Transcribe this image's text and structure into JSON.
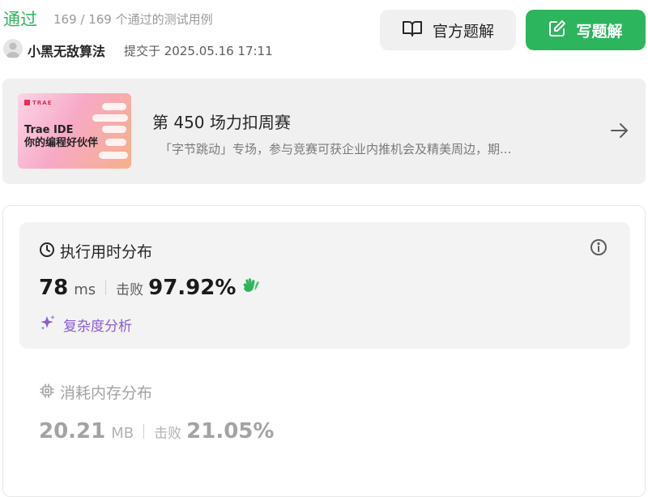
{
  "header": {
    "status": "通过",
    "passed_cases": "169 / 169 个通过的测试用例",
    "user_name": "小黑无敌算法",
    "submitted": "提交于 2025.05.16 17:11",
    "official_solution_label": "官方题解",
    "write_solution_label": "写题解"
  },
  "banner": {
    "promo_logo": "TRAE",
    "promo_title_line1": "Trae IDE",
    "promo_title_line2": "你的编程好伙伴",
    "title": "第 450 场力扣周赛",
    "description": "「字节跳动」专场，参与竞赛可获企业内推机会及精美周边，期..."
  },
  "runtime": {
    "title": "执行用时分布",
    "value": "78",
    "unit": "ms",
    "beat_label": "击败",
    "beat_percent": "97.92%",
    "analysis_label": "复杂度分析"
  },
  "memory": {
    "title": "消耗内存分布",
    "value": "20.21",
    "unit": "MB",
    "beat_label": "击败",
    "beat_percent": "21.05%"
  },
  "colors": {
    "accent_green": "#2db55d",
    "analysis_purple": "#8c5cd6",
    "muted_gray": "#a3a3a3"
  },
  "icons": [
    "avatar-icon",
    "book-open-icon",
    "edit-icon",
    "arrow-right-icon",
    "clock-icon",
    "info-icon",
    "clap-icon",
    "sparkle-icon",
    "chip-icon"
  ]
}
